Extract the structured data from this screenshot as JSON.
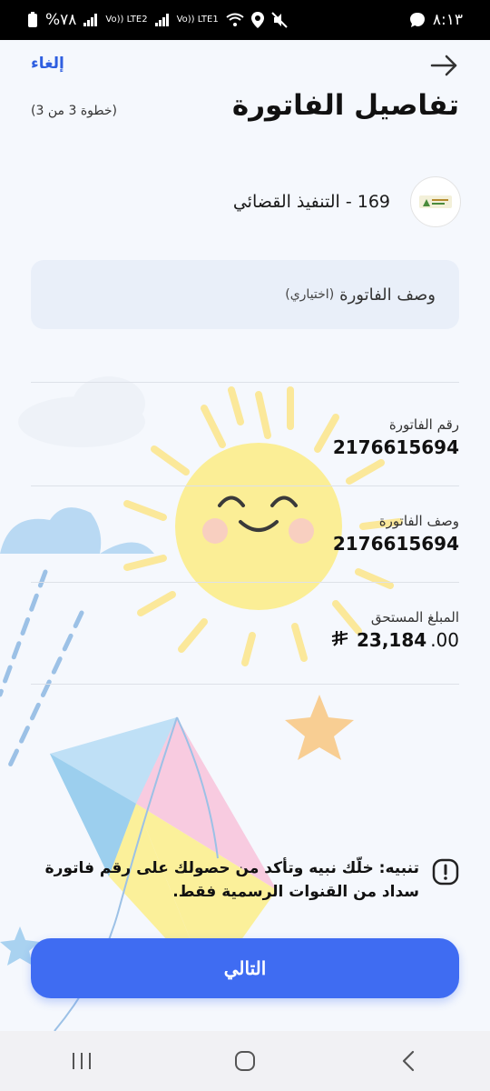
{
  "status_bar": {
    "battery": "%٧٨",
    "signal_1": "Vo)) LTE2",
    "signal_2": "Vo)) LTE1",
    "time": "٨:١٣"
  },
  "header": {
    "cancel_label": "إلغاء",
    "title": "تفاصيل الفاتورة",
    "step_label": "(خطوة 3 من 3)"
  },
  "biller": {
    "name": "169 - التنفيذ القضائي",
    "logo_icon": "judicial-emblem-icon"
  },
  "description_field": {
    "placeholder_main": "وصف الفاتورة",
    "placeholder_sub": "(اختياري)",
    "value": ""
  },
  "details": [
    {
      "label": "رقم الفاتورة",
      "value": "2176615694"
    },
    {
      "label": "وصف الفاتورة",
      "value": "2176615694"
    }
  ],
  "amount": {
    "label": "المبلغ المستحق",
    "integer_part": "23,184",
    "decimal_part": ".00",
    "currency_icon": "saudi-riyal-icon"
  },
  "notice": {
    "icon": "exclamation-icon",
    "text": "تنبيه: خلّك نبيه وتأكد من حصولك على رقم فاتورة سداد من القنوات الرسمية فقط."
  },
  "next_button_label": "التالي",
  "nav": {
    "recents": "recents-icon",
    "home": "home-icon",
    "back": "back-icon"
  },
  "colors": {
    "accent": "#3f6cf2",
    "link": "#2f5fe0",
    "background": "#f5f8fd",
    "field_bg": "#e9eff9"
  }
}
